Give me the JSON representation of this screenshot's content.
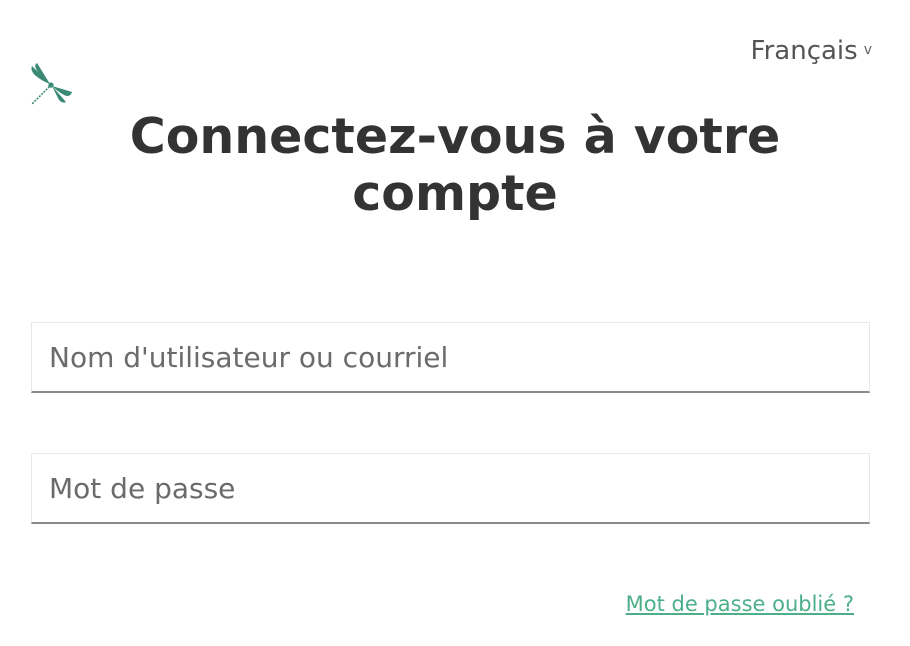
{
  "header": {
    "language_label": "Français",
    "language_chevron": "v",
    "logo_icon": "dragonfly-icon",
    "brand_color": "#3a8a73"
  },
  "login": {
    "title_line1": "Connectez-vous à votre",
    "title_line2": "compte",
    "username_placeholder": "Nom d'utilisateur ou courriel",
    "username_value": "",
    "password_placeholder": "Mot de passe",
    "password_value": "",
    "forgot_password_label": "Mot de passe oublié ?",
    "link_color": "#4caf8a"
  }
}
